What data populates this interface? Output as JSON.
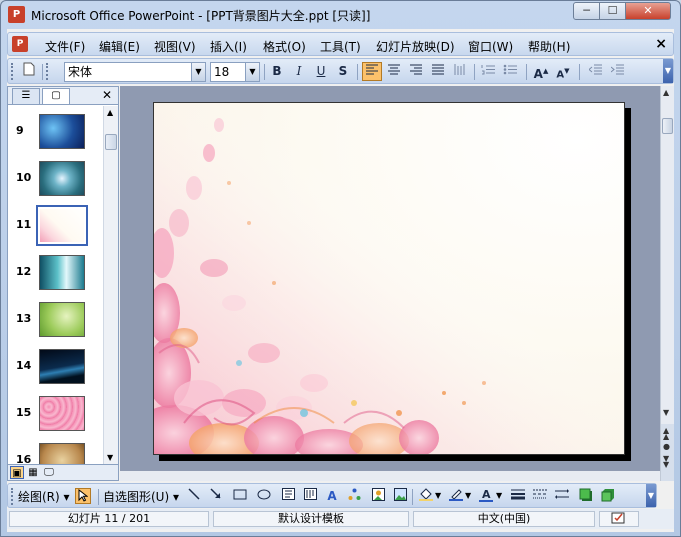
{
  "window": {
    "app_icon_glyph": "P",
    "title": "Microsoft Office PowerPoint - [PPT背景图片大全.ppt [只读]]",
    "min_glyph": "─",
    "max_glyph": "☐",
    "close_glyph": "✕"
  },
  "menubar": {
    "doc_icon_glyph": "P",
    "items": [
      "文件(F)",
      "编辑(E)",
      "视图(V)",
      "插入(I)",
      "格式(O)",
      "工具(T)",
      "幻灯片放映(D)",
      "窗口(W)",
      "帮助(H)"
    ],
    "close_glyph": "×"
  },
  "toolbar": {
    "font_name": "宋体",
    "font_size": "18",
    "bold": "B",
    "italic": "I",
    "underline": "U",
    "shadow": "S",
    "active_align": "align-left"
  },
  "left_panel": {
    "tab_outline_glyph": "☰",
    "tab_slides_glyph": "▢",
    "close_glyph": "✕",
    "slides": [
      {
        "num": "9",
        "theme": "blue-water"
      },
      {
        "num": "10",
        "theme": "teal-bokeh"
      },
      {
        "num": "11",
        "theme": "floral-white",
        "selected": true
      },
      {
        "num": "12",
        "theme": "teal-waterfall"
      },
      {
        "num": "13",
        "theme": "green-bokeh"
      },
      {
        "num": "14",
        "theme": "dark-wave"
      },
      {
        "num": "15",
        "theme": "pink-texture"
      },
      {
        "num": "16",
        "theme": "parchment"
      }
    ]
  },
  "drawbar": {
    "draw_label": "绘图(R)",
    "autoshapes_label": "自选图形(U)"
  },
  "statusbar": {
    "slide_info": "幻灯片 11 / 201",
    "design": "默认设计模板",
    "language": "中文(中国)"
  },
  "colors": {
    "accent": "#3b63b5",
    "active_button": "#fbc16b",
    "editor_bg": "#8f9ab1"
  }
}
